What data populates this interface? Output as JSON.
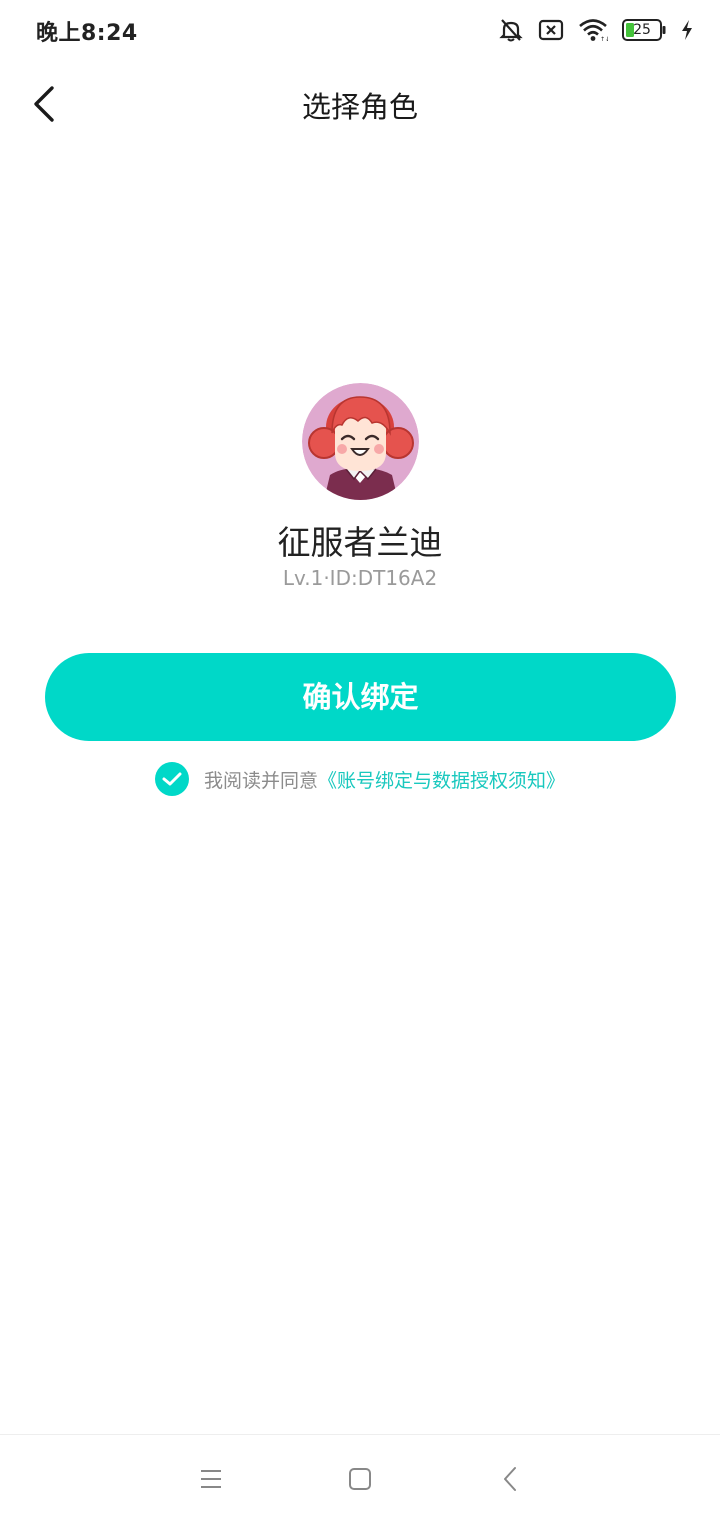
{
  "status_bar": {
    "time": "晚上8:24",
    "battery": "25",
    "icons": [
      "bell-muted-icon",
      "sim-error-icon",
      "wifi-icon",
      "battery-icon",
      "charging-icon"
    ]
  },
  "header": {
    "title": "选择角色",
    "back_icon": "chevron-left-icon"
  },
  "role": {
    "name": "征服者兰迪",
    "meta": "Lv.1·ID:DT16A2"
  },
  "actions": {
    "confirm_label": "确认绑定"
  },
  "agreement": {
    "checked": true,
    "prefix": "我阅读并同意",
    "link": "《账号绑定与数据授权须知》"
  },
  "system_nav": [
    "menu-icon",
    "home-icon",
    "back-icon"
  ],
  "colors": {
    "accent": "#00d8c8",
    "link": "#19c8be",
    "avatar_bg": "#dfa9cf",
    "hair": "#e5534e"
  }
}
